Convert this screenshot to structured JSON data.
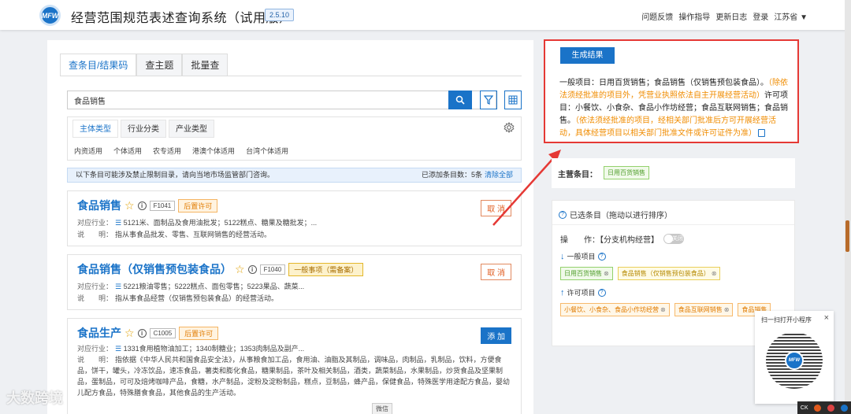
{
  "header": {
    "logo_text": "MFW",
    "title": "经营范围规范表述查询系统（试用版）",
    "version": "2.5.10",
    "links": [
      "问题反馈",
      "操作指导",
      "更新日志",
      "登录"
    ],
    "region": "江苏省 ▼"
  },
  "tabs": [
    {
      "label": "查条目/结果码",
      "active": true
    },
    {
      "label": "查主题",
      "active": false
    },
    {
      "label": "批量查",
      "active": false
    }
  ],
  "search": {
    "value": "食品销售",
    "placeholder": ""
  },
  "subtabs": [
    {
      "label": "主体类型",
      "active": true
    },
    {
      "label": "行业分类",
      "active": false
    },
    {
      "label": "产业类型",
      "active": false
    }
  ],
  "entity_types": [
    "内资适用",
    "个体适用",
    "农专适用",
    "港澳个体适用",
    "台湾个体适用"
  ],
  "notice": {
    "text": "以下条目可能涉及禁止限制目录，请向当地市场监管部门咨询。",
    "added": "已添加条目数：5条",
    "clear": "清除全部"
  },
  "cards": [
    {
      "name": "食品销售",
      "code": "F1041",
      "tag": "后置许可",
      "btn": "取 消",
      "industry_label": "对应行业：",
      "industry": "5121米、面制品及食用油批发；5122糕点、糖果及糖批发；...",
      "desc_label": "说　　明：",
      "desc": "指从事食品批发、零售、互联网销售的经营活动。"
    },
    {
      "name": "食品销售（仅销售预包装食品）",
      "code": "F1040",
      "tag": "一般事项（需备案）",
      "btn": "取 消",
      "industry_label": "对应行业：",
      "industry": "5221粮油零售；5222糕点、面包零售；5223果品、蔬菜...",
      "desc_label": "说　　明：",
      "desc": "指从事食品经营（仅销售预包装食品）的经营活动。"
    },
    {
      "name": "食品生产",
      "code": "C1005",
      "tag": "后置许可",
      "btn": "添 加",
      "industry_label": "对应行业：",
      "industry": "1331食用植物油加工；1340制糖业；1353肉制品及副产...",
      "desc_label": "说　　明：",
      "desc": "指依据《中华人民共和国食品安全法》，从事粮食加工品，食用油、油脂及其制品，调味品，肉制品，乳制品，饮料，方便食品，饼干，罐头，冷冻饮品，速冻食品，薯类和膨化食品，糖果制品，茶叶及相关制品，酒类，蔬菜制品，水果制品，炒货食品及坚果制品，蛋制品，可可及焙烤咖啡产品，食糖，水产制品，淀粉及淀粉制品，糕点，豆制品，蜂产品，保健食品，特殊医学用途配方食品，婴幼儿配方食品，特殊膳食食品，其他食品的生产活动。"
    }
  ],
  "wechat_tab": "微信",
  "result": {
    "button": "生成结果",
    "general": "一般项目：日用百货销售；食品销售（仅销售预包装食品）。",
    "general_note": "（除依法须经批准的项目外，凭营业执照依法自主开展经营活动）",
    "permit": "许可项目：小餐饮、小食杂、食品小作坊经营；食品互联网销售；食品销售。",
    "permit_note": "（依法须经批准的项目，经相关部门批准后方可开展经营活动，具体经营项目以相关部门批准文件或许可证件为准）"
  },
  "main_item": {
    "label": "主营条目：",
    "tag": "日用百货销售"
  },
  "selected": {
    "title": "已选条目（拖动以进行排序）",
    "operation_label": "操　　作：【分支机构经营】",
    "toggle": "关闭",
    "general_label": "一般项目",
    "general_tags": [
      "日用百货销售",
      "食品销售（仅销售预包装食品）"
    ],
    "permit_label": "许可项目",
    "permit_tags": [
      "小餐饮、小食杂、食品小作坊经营",
      "食品互联网销售",
      "食品销售"
    ]
  },
  "qr": {
    "text": "扫一扫打开小程序",
    "close": "×"
  },
  "watermark": "大数跨境",
  "tray": "CK",
  "colors": {
    "primary": "#1a73c8",
    "orange": "#f08c00",
    "red_highlight": "#e53935",
    "green": "#4f9d2b"
  }
}
